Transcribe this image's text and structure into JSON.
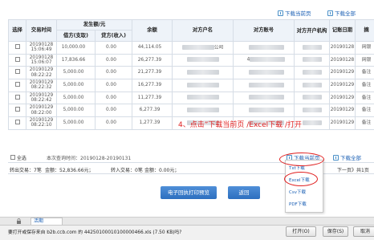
{
  "top_links": {
    "download_current": "下载当前页",
    "download_all": "下载全部"
  },
  "table": {
    "headers": {
      "select": "选择",
      "txn_time": "交易时间",
      "amount_group": "发生额/元",
      "debit": "借方(支取)",
      "credit": "贷方(收入)",
      "balance": "余额",
      "counter_name": "对方户名",
      "counter_account": "对方账号",
      "counter_bank": "对方开户机构",
      "record_date": "记账日期",
      "more": "摘"
    },
    "rows": [
      {
        "date": "20190128",
        "time": "15:06:49",
        "debit": "10,000.00",
        "credit": "0.00",
        "balance": "44,114.05",
        "name_suffix": "公司",
        "acct_prefix": "",
        "record": "20190128",
        "memo": "网银"
      },
      {
        "date": "20190128",
        "time": "15:06:07",
        "debit": "17,836.66",
        "credit": "0.00",
        "balance": "26,277.39",
        "name_suffix": "",
        "acct_prefix": "4",
        "record": "20190128",
        "memo": "网银"
      },
      {
        "date": "20190129",
        "time": "08:22:22",
        "debit": "5,000.00",
        "credit": "0.00",
        "balance": "21,277.39",
        "name_suffix": "",
        "acct_prefix": "",
        "record": "20190129",
        "memo": "备注"
      },
      {
        "date": "20190129",
        "time": "08:22:32",
        "debit": "5,000.00",
        "credit": "0.00",
        "balance": "16,277.39",
        "name_suffix": "",
        "acct_prefix": "",
        "record": "20190129",
        "memo": "备注"
      },
      {
        "date": "20190129",
        "time": "08:22:42",
        "debit": "5,000.00",
        "credit": "0.00",
        "balance": "11,277.39",
        "name_suffix": "",
        "acct_prefix": "",
        "record": "20190129",
        "memo": "备注"
      },
      {
        "date": "20190129",
        "time": "08:22:00",
        "debit": "5,000.00",
        "credit": "0.00",
        "balance": "6,277.39",
        "name_suffix": "",
        "acct_prefix": "",
        "record": "20190129",
        "memo": "备注"
      },
      {
        "date": "20190129",
        "time": "08:22:10",
        "debit": "5,000.00",
        "credit": "0.00",
        "balance": "1,277.39",
        "name_suffix": "",
        "acct_prefix": "",
        "record": "20190129",
        "memo": "备注"
      }
    ]
  },
  "footer": {
    "select_all": "全选",
    "query_range": "本次查询时间：20190128-20190131",
    "download_current": "下载当前页",
    "download_all": "下载全部"
  },
  "stats": {
    "out_count": "转出交易：7笔",
    "out_amount": "金额：52,836.66元；",
    "in_count": "转入交易：0笔",
    "in_amount": "金额：0.00元；",
    "pager": "下一页》共1页"
  },
  "annotation": "4、点击”下载当前页 /Excel下载 /打开",
  "buttons": {
    "print_preview": "电子回执打印预览",
    "back": "返回"
  },
  "download_menu": [
    "Txt下载",
    "Excel下载",
    "Csv下载",
    "PDF下载"
  ],
  "tab_label": "活期",
  "download_bar": {
    "prompt": "要打开或保存来自 b2b.ccb.com 的 44250100010100000466.xls (7.50 KB)吗?",
    "open": "打开(O)",
    "save": "保存(S)",
    "cancel": "取消"
  }
}
